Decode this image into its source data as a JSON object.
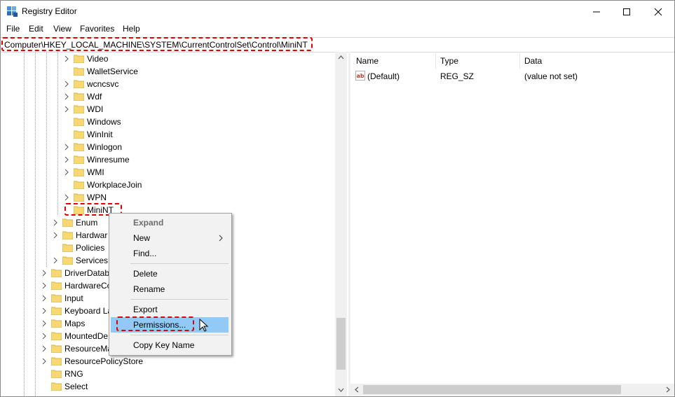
{
  "window": {
    "title": "Registry Editor"
  },
  "menu": [
    "File",
    "Edit",
    "View",
    "Favorites",
    "Help"
  ],
  "address": {
    "path": "Computer\\HKEY_LOCAL_MACHINE\\SYSTEM\\CurrentControlSet\\Control\\MiniNT"
  },
  "tree": {
    "level3": [
      "Video",
      "WalletService",
      "wcncsvc",
      "Wdf",
      "WDI",
      "Windows",
      "WinInit",
      "Winlogon",
      "Winresume",
      "WMI",
      "WorkplaceJoin",
      "WPN",
      "MiniNT"
    ],
    "level2": [
      "Enum",
      "Hardwar",
      "Policies",
      "Services"
    ],
    "level1": [
      "DriverDatab",
      "HardwareCo",
      "Input",
      "Keyboard La",
      "Maps",
      "MountedDe",
      "ResourceMa",
      "ResourcePolicyStore",
      "RNG",
      "Select"
    ]
  },
  "values_pane": {
    "columns": [
      "Name",
      "Type",
      "Data"
    ],
    "rows": [
      {
        "name": "(Default)",
        "type": "REG_SZ",
        "data": "(value not set)"
      }
    ]
  },
  "context_menu": {
    "items": [
      "Expand",
      "New",
      "Find...",
      "Delete",
      "Rename",
      "Export",
      "Permissions...",
      "Copy Key Name"
    ],
    "selected": "Permissions..."
  },
  "colors": {
    "highlight_box": "#e00000",
    "menu_selection": "#91c9f7",
    "folder": "#f8d775"
  }
}
